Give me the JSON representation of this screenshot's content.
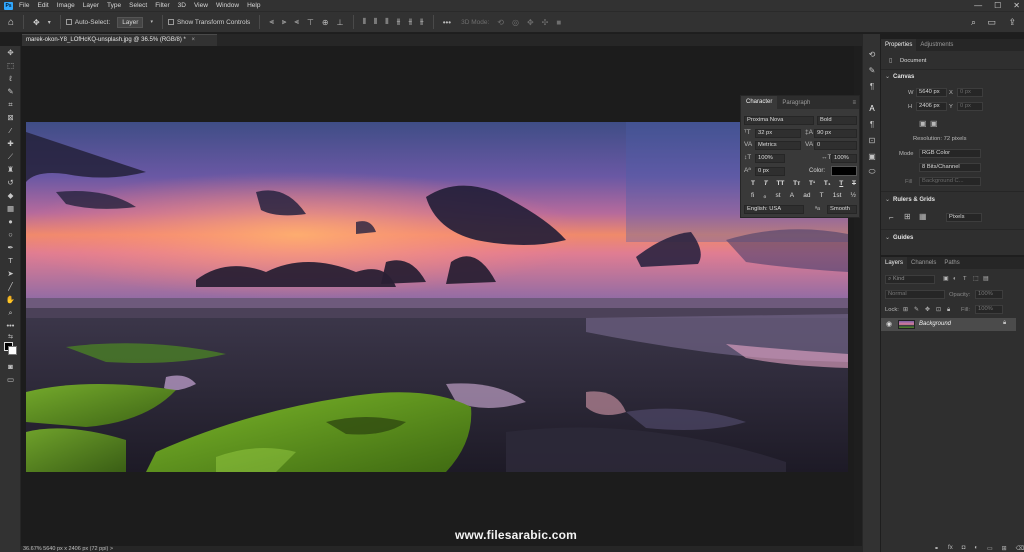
{
  "menubar": {
    "logo": "Ps",
    "items": [
      "File",
      "Edit",
      "Image",
      "Layer",
      "Type",
      "Select",
      "Filter",
      "3D",
      "View",
      "Window",
      "Help"
    ],
    "window_controls": [
      "—",
      "☐",
      "✕"
    ]
  },
  "options_bar": {
    "auto_select_label": "Auto-Select:",
    "auto_select_value": "Layer",
    "transform_label": "Show Transform Controls",
    "mode_3d_label": "3D Mode:",
    "more_label": "•••"
  },
  "document": {
    "tab_label": "marek-okon-Y8_LOfHcKQ-unsplash.jpg @ 36.5% (RGB/8) *",
    "close": "×"
  },
  "status_bar": {
    "text": "36.67%    5640 px x 2406 px (72 ppi)  >"
  },
  "character_panel": {
    "tabs": [
      "Character",
      "Paragraph"
    ],
    "font_family": "Proxima Nova",
    "font_style": "Bold",
    "font_size": "32 px",
    "leading": "90 px",
    "kerning": "Metrics",
    "tracking": "0",
    "vertical_scale": "100%",
    "horizontal_scale": "100%",
    "baseline_shift": "0 px",
    "color_label": "Color:",
    "text_color": "#000000",
    "style_buttons": [
      "T",
      "T",
      "TT",
      "Tт",
      "T¹",
      "T₁",
      "T",
      "T"
    ],
    "opentype_buttons": [
      "fi",
      "ℴ",
      "st",
      "A",
      "ad",
      "T",
      "1st",
      "½"
    ],
    "language": "English: USA",
    "antialias_prefix": "ªa",
    "antialias": "Smooth"
  },
  "properties_panel": {
    "tabs": [
      "Properties",
      "Adjustments"
    ],
    "doc_label": "Document",
    "canvas_title": "Canvas",
    "w_label": "W",
    "w_value": "5640 px",
    "x_label": "X",
    "x_placeholder": "0 px",
    "h_label": "H",
    "h_value": "2406 px",
    "y_label": "Y",
    "y_placeholder": "0 px",
    "resolution": "Resolution: 72 pixels",
    "mode_label": "Mode",
    "mode_value": "RGB Color",
    "bits_value": "8 Bits/Channel",
    "fill_label": "Fill",
    "fill_value": "Background C...",
    "rulers_title": "Rulers & Grids",
    "units_value": "Pixels",
    "guides_title": "Guides"
  },
  "layers_panel": {
    "tabs": [
      "Layers",
      "Channels",
      "Paths"
    ],
    "filter_kind": "Kind",
    "blend_mode": "Normal",
    "opacity_label": "Opacity:",
    "opacity_value": "100%",
    "lock_label": "Lock:",
    "fill_label": "Fill:",
    "fill_value": "100%",
    "layer_name": "Background"
  },
  "watermark": "www.filesarabic.com",
  "colors": {
    "app_bg": "#1e1e1e",
    "panel_bg": "#2f2f2f",
    "bar_bg": "#323232",
    "accent": "#31a8ff",
    "selected_layer": "#4b4b4b"
  }
}
